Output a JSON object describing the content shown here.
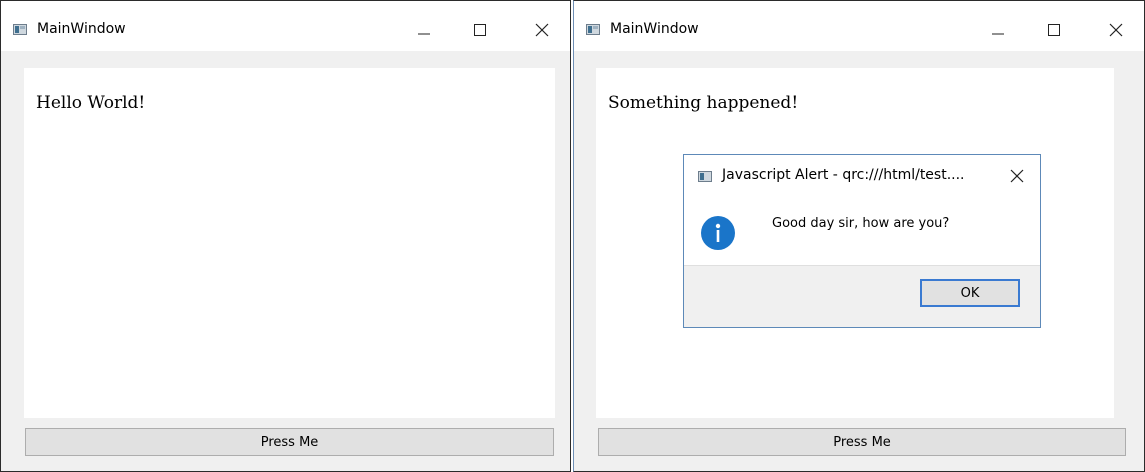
{
  "windows": [
    {
      "title": "MainWindow",
      "content_text": "Hello World!",
      "button_label": "Press Me"
    },
    {
      "title": "MainWindow",
      "content_text": "Something happened!",
      "button_label": "Press Me"
    }
  ],
  "dialog": {
    "title": "Javascript Alert - qrc:///html/test....",
    "message": "Good day sir, how are you?",
    "ok_label": "OK",
    "icon": "info-icon"
  },
  "colors": {
    "dialog_border": "#5d89b8",
    "info_icon": "#1a75c9",
    "default_button_border": "#3a7ad1"
  }
}
